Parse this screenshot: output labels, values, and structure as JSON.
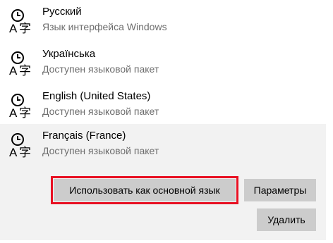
{
  "languages": [
    {
      "name": "Русский",
      "status": "Язык интерфейса Windows"
    },
    {
      "name": "Українська",
      "status": "Доступен языковой пакет"
    },
    {
      "name": "English (United States)",
      "status": "Доступен языковой пакет"
    },
    {
      "name": "Français (France)",
      "status": "Доступен языковой пакет"
    }
  ],
  "selected_actions": {
    "set_default_label": "Использовать как основной язык",
    "options_label": "Параметры",
    "remove_label": "Удалить"
  },
  "icons": {
    "language": "language-icon"
  },
  "colors": {
    "highlight_border": "#e81123",
    "button_bg": "#cccccc",
    "selected_bg": "#f2f2f2",
    "secondary_text": "#6d6d6d"
  }
}
